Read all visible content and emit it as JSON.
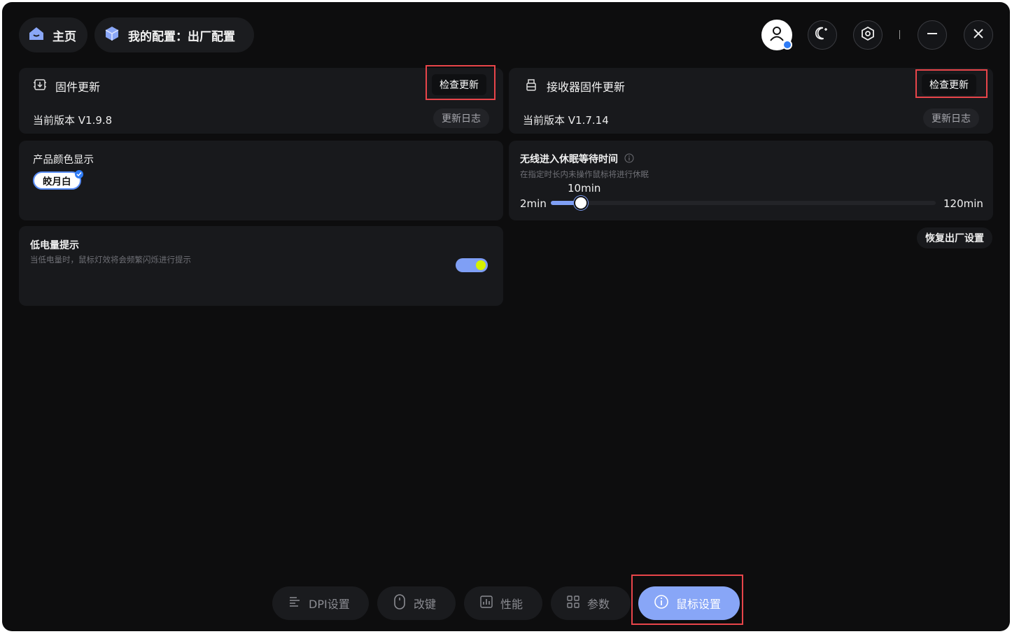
{
  "header": {
    "home_label": "主页",
    "config_label": "我的配置：出厂配置",
    "icons": [
      "home-icon",
      "cube-icon",
      "user-icon",
      "moon-icon",
      "settings-icon",
      "minimize-icon",
      "close-icon"
    ]
  },
  "firmware": {
    "title": "固件更新",
    "check_label": "检查更新",
    "version": "当前版本 V1.9.8",
    "log_label": "更新日志"
  },
  "receiver": {
    "title": "接收器固件更新",
    "check_label": "检查更新",
    "version": "当前版本 V1.7.14",
    "log_label": "更新日志"
  },
  "color": {
    "title": "产品颜色显示",
    "selected": "皎月白"
  },
  "sleep": {
    "title": "无线进入休眠等待时间",
    "desc": "在指定时长内未操作鼠标将进行休眠",
    "min_label": "2min",
    "max_label": "120min",
    "current_label": "10min",
    "min": 2,
    "max": 120,
    "value": 10
  },
  "battery": {
    "title": "低电量提示",
    "desc": "当低电量时，鼠标灯效将会频繁闪烁进行提示",
    "enabled": true
  },
  "reset_label": "恢复出厂设置",
  "nav": {
    "dpi": "DPI设置",
    "keys": "改键",
    "performance": "性能",
    "params": "参数",
    "mouse": "鼠标设置",
    "active": "鼠标设置"
  },
  "colors": {
    "accent": "#88a6f7",
    "highlight": "#e8454a",
    "toggle_knob": "#d5f200"
  }
}
